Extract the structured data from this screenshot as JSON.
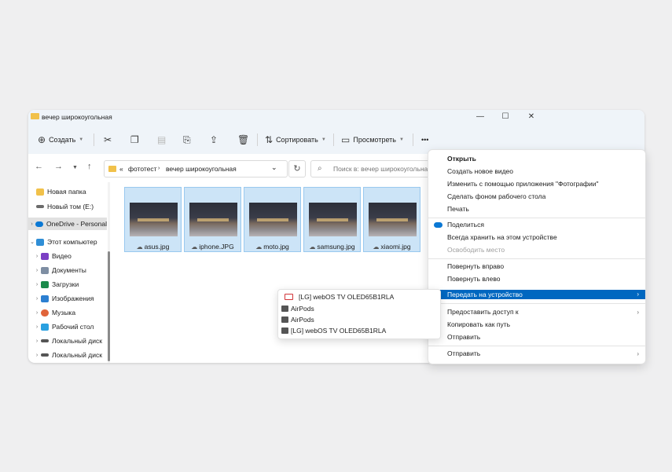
{
  "window": {
    "title": "вечер широкоугольная",
    "controls": {
      "minimize": "—",
      "maximize": "☐",
      "close": "✕"
    }
  },
  "toolbar": {
    "create_label": "Создать",
    "sort_label": "Сортировать",
    "view_label": "Просмотреть",
    "more_label": "•••",
    "icons": [
      "cut-icon",
      "copy-icon",
      "paste-icon",
      "rename-icon",
      "share-icon",
      "delete-icon"
    ]
  },
  "address": {
    "overflow": "«",
    "crumbs": [
      "фототест",
      "вечер широкоугольная"
    ],
    "search_placeholder": "Поиск в: вечер широкоугольная"
  },
  "sidebar": {
    "items": [
      {
        "label": "Новая папка",
        "color": "#f1c14a"
      },
      {
        "label": "Новый том (E:)",
        "color": "#6b6b6b"
      },
      {
        "label": "OneDrive - Personal",
        "color": "#0a78d4"
      },
      {
        "label": "Этот компьютер",
        "color": "#2f8ed6"
      },
      {
        "label": "Видео",
        "color": "#7b3fc4"
      },
      {
        "label": "Документы",
        "color": "#7e8ea3"
      },
      {
        "label": "Загрузки",
        "color": "#1a8a4a"
      },
      {
        "label": "Изображения",
        "color": "#2c7fd1"
      },
      {
        "label": "Музыка",
        "color": "#e0643a"
      },
      {
        "label": "Рабочий стол",
        "color": "#2aa0e0"
      },
      {
        "label": "Локальный диск",
        "color": "#555555"
      },
      {
        "label": "Локальный диск",
        "color": "#555555"
      }
    ]
  },
  "files": [
    {
      "name": "asus.jpg"
    },
    {
      "name": "iphone.JPG"
    },
    {
      "name": "moto.jpg"
    },
    {
      "name": "samsung.jpg"
    },
    {
      "name": "xiaomi.jpg"
    }
  ],
  "context_menu": {
    "items": [
      "Открыть",
      "Создать новое видео",
      "Изменить с помощью приложения \"Фотографии\"",
      "Сделать фоном рабочего стола",
      "Печать",
      "Поделиться",
      "Всегда хранить на этом устройстве",
      "Освободить место",
      "Повернуть вправо",
      "Повернуть влево",
      "Передать на устройство",
      "Предоставить доступ к",
      "Копировать как путь",
      "Отправить",
      "Отправить"
    ]
  },
  "submenu": {
    "items": [
      "[LG] webOS TV OLED65B1RLA",
      "AirPods",
      "AirPods",
      "[LG] webOS TV OLED65B1RLA"
    ]
  },
  "colors": {
    "accent": "#0067c0",
    "selection": "#cce4f7",
    "folder": "#f1c14a"
  }
}
